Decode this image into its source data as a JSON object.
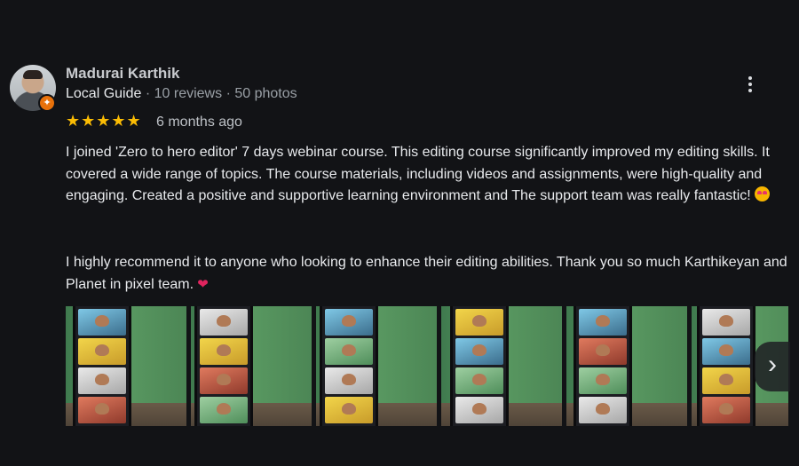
{
  "reviewer": {
    "name": "Madurai Karthik",
    "badge": "Local Guide",
    "sep1": "·",
    "reviews": "10 reviews",
    "sep2": "·",
    "photos": "50 photos"
  },
  "rating": {
    "stars_text": "★★★★★",
    "value": 5,
    "max": 5,
    "time_ago": "6 months ago",
    "star_color": "#fbbc04"
  },
  "review": {
    "paragraph1": "I joined 'Zero to hero editor' 7 days webinar course. This editing course significantly improved my editing skills. It covered a wide range of topics. The course materials, including videos and assignments, were high-quality and engaging. Created a positive and supportive learning environment and The support team was really fantastic!",
    "paragraph2": "I highly recommend it to anyone who looking to enhance their editing abilities. Thank you so much Karthikeyan and Planet in pixel team.",
    "emoji1": "star-struck-emoji",
    "emoji2": "heart-emoji"
  },
  "icons": {
    "more": "more-vert-icon",
    "next": "chevron-right-icon",
    "next_glyph": "›",
    "badge": "local-guide-badge-icon",
    "badge_glyph": "✦",
    "heart_glyph": "❤"
  },
  "photos_count_visible": 6,
  "colors": {
    "background": "#121316",
    "text": "#e8eaed",
    "muted": "#9aa0a6",
    "accent_badge": "#e8710a"
  }
}
